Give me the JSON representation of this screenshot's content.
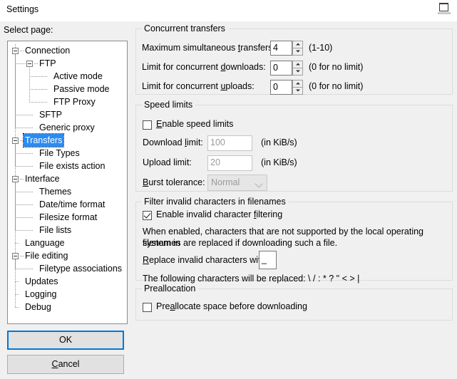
{
  "window": {
    "title": "Settings",
    "restore_icon": "restore-window-icon"
  },
  "sidebar": {
    "label": "Select page:",
    "selected": "Transfers",
    "items": [
      {
        "label": "Connection",
        "depth": 0,
        "expander": "collapse"
      },
      {
        "label": "FTP",
        "depth": 1,
        "expander": "collapse"
      },
      {
        "label": "Active mode",
        "depth": 2,
        "expander": "none"
      },
      {
        "label": "Passive mode",
        "depth": 2,
        "expander": "none"
      },
      {
        "label": "FTP Proxy",
        "depth": 2,
        "expander": "none"
      },
      {
        "label": "SFTP",
        "depth": 1,
        "expander": "none"
      },
      {
        "label": "Generic proxy",
        "depth": 1,
        "expander": "none"
      },
      {
        "label": "Transfers",
        "depth": 0,
        "expander": "collapse"
      },
      {
        "label": "File Types",
        "depth": 1,
        "expander": "none"
      },
      {
        "label": "File exists action",
        "depth": 1,
        "expander": "none"
      },
      {
        "label": "Interface",
        "depth": 0,
        "expander": "collapse"
      },
      {
        "label": "Themes",
        "depth": 1,
        "expander": "none"
      },
      {
        "label": "Date/time format",
        "depth": 1,
        "expander": "none"
      },
      {
        "label": "Filesize format",
        "depth": 1,
        "expander": "none"
      },
      {
        "label": "File lists",
        "depth": 1,
        "expander": "none"
      },
      {
        "label": "Language",
        "depth": 0,
        "expander": "none"
      },
      {
        "label": "File editing",
        "depth": 0,
        "expander": "collapse"
      },
      {
        "label": "Filetype associations",
        "depth": 1,
        "expander": "none"
      },
      {
        "label": "Updates",
        "depth": 0,
        "expander": "none"
      },
      {
        "label": "Logging",
        "depth": 0,
        "expander": "none"
      },
      {
        "label": "Debug",
        "depth": 0,
        "expander": "none"
      }
    ]
  },
  "buttons": {
    "ok": "OK",
    "cancel_pre": "",
    "cancel_accel": "C",
    "cancel_post": "ancel"
  },
  "concurrent": {
    "title": "Concurrent transfers",
    "max_label_pre": "Maximum simultaneous ",
    "max_label_accel": "t",
    "max_label_post": "ransfers:",
    "max_value": "4",
    "max_hint": "(1-10)",
    "downloads_label_pre": "Limit for concurrent ",
    "downloads_label_accel": "d",
    "downloads_label_post": "ownloads:",
    "downloads_value": "0",
    "downloads_hint": "(0 for no limit)",
    "uploads_label_pre": "Limit for concurrent ",
    "uploads_label_accel": "u",
    "uploads_label_post": "ploads:",
    "uploads_value": "0",
    "uploads_hint": "(0 for no limit)"
  },
  "speed": {
    "title": "Speed limits",
    "enable_pre": "",
    "enable_accel": "E",
    "enable_post": "nable speed limits",
    "enable_checked": false,
    "download_label_pre": "Download ",
    "download_label_accel": "l",
    "download_label_post": "imit:",
    "download_value": "100",
    "download_unit": "(in KiB/s)",
    "upload_label_pre": "Upload limit:",
    "upload_value": "20",
    "upload_unit": "(in KiB/s)",
    "burst_label_pre": "",
    "burst_label_accel": "B",
    "burst_label_post": "urst tolerance:",
    "burst_value": "Normal",
    "burst_options": [
      "Normal"
    ]
  },
  "filter": {
    "title": "Filter invalid characters in filenames",
    "enable_pre": "Enable invalid character ",
    "enable_accel": "f",
    "enable_post": "iltering",
    "enable_checked": true,
    "description_line1": "When enabled, characters that are not supported by the local operating system in",
    "description_line2": "filenames are replaced if downloading such a file.",
    "replace_label_pre": "",
    "replace_label_accel": "R",
    "replace_label_post": "eplace invalid characters with:",
    "replace_value": "_",
    "replaced_chars_text": "The following characters will be replaced: \\ / : * ? \" < > |"
  },
  "preallocation": {
    "title": "Preallocation",
    "enable_pre": "Pre",
    "enable_accel": "a",
    "enable_post": "llocate space before downloading",
    "enable_checked": false
  }
}
